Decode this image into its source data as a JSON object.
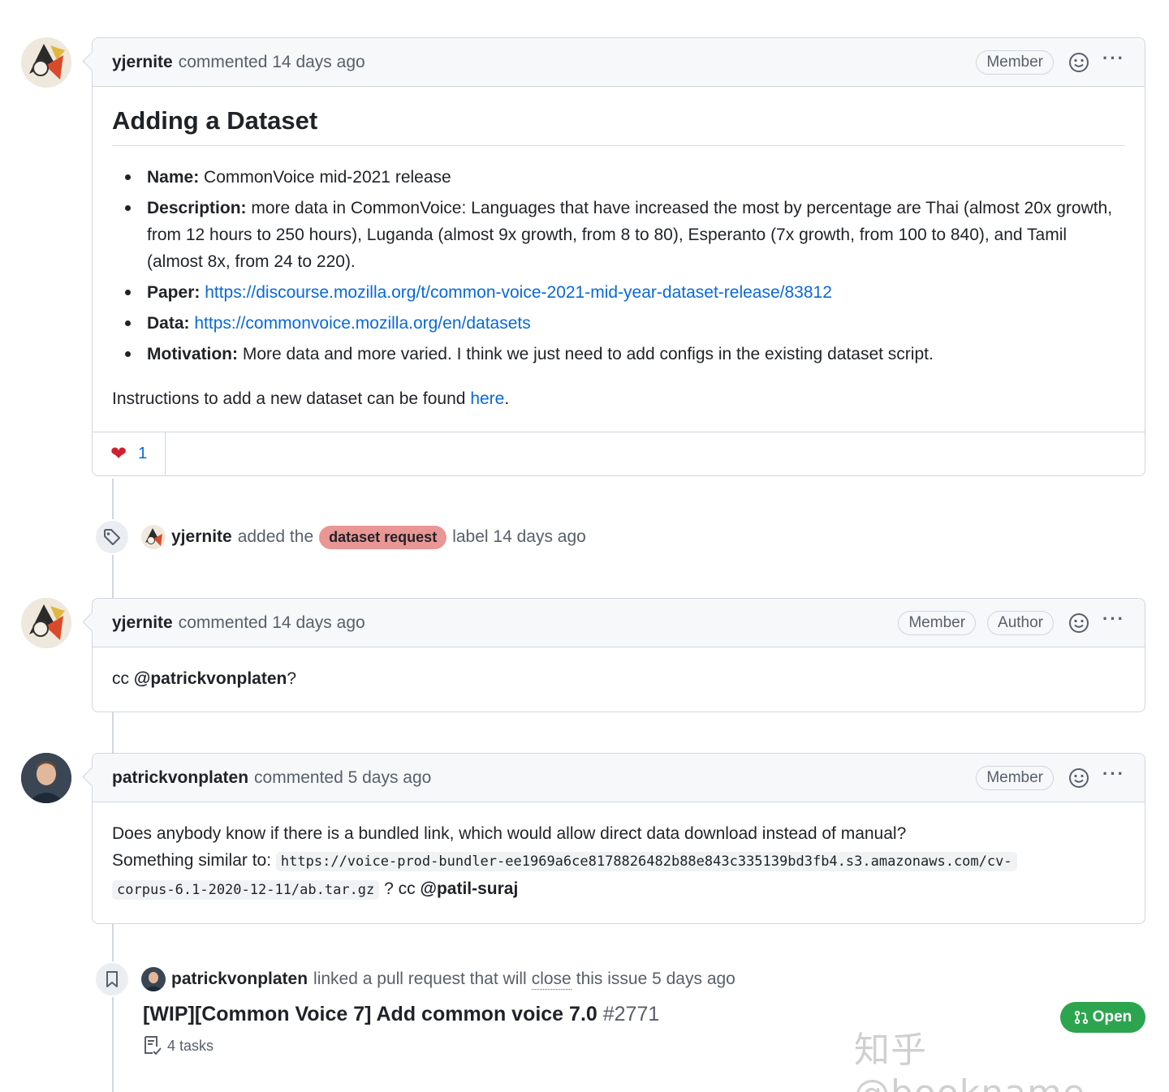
{
  "comments": [
    {
      "author": "yjernite",
      "meta": "commented 14 days ago",
      "badges": [
        "Member"
      ],
      "heading": "Adding a Dataset",
      "items": [
        {
          "label": "Name:",
          "text": "CommonVoice mid-2021 release"
        },
        {
          "label": "Description:",
          "text": "more data in CommonVoice: Languages that have increased the most by percentage are Thai (almost 20x growth, from 12 hours to 250 hours), Luganda (almost 9x growth, from 8 to 80), Esperanto (7x growth, from 100 to 840), and Tamil (almost 8x, from 24 to 220)."
        },
        {
          "label": "Paper:",
          "link": "https://discourse.mozilla.org/t/common-voice-2021-mid-year-dataset-release/83812"
        },
        {
          "label": "Data:",
          "link": "https://commonvoice.mozilla.org/en/datasets"
        },
        {
          "label": "Motivation:",
          "text": "More data and more varied. I think we just need to add configs in the existing dataset script."
        }
      ],
      "footer_text": "Instructions to add a new dataset can be found",
      "footer_link": "here",
      "footer_end": ".",
      "reaction_count": "1"
    },
    {
      "author": "yjernite",
      "meta": "commented 14 days ago",
      "badges": [
        "Member",
        "Author"
      ],
      "body_prefix": "cc",
      "body_mention": "@patrickvonplaten",
      "body_suffix": "?"
    },
    {
      "author": "patrickvonplaten",
      "meta": "commented 5 days ago",
      "badges": [
        "Member"
      ],
      "line1": "Does anybody know if there is a bundled link, which would allow direct data download instead of manual?",
      "line2_prefix": "Something similar to:",
      "code_part1": "https://voice-prod-bundler-ee1969a6ce8178826482b88e843c335139bd3fb4.s3.amazonaws.com/cv-",
      "code_part2": "corpus-6.1-2020-12-11/ab.tar.gz",
      "line2_suffix": "? cc",
      "mention": "@patil-suraj"
    }
  ],
  "label_event": {
    "actor": "yjernite",
    "text_before": "added the",
    "label": "dataset request",
    "text_after": "label 14 days ago"
  },
  "link_event": {
    "actor": "patrickvonplaten",
    "text_before": "linked a pull request that will",
    "keyword": "close",
    "text_after": "this issue 5 days ago"
  },
  "pull_request": {
    "title": "[WIP][Common Voice 7] Add common voice 7.0",
    "number": "#2771",
    "tasks": "4 tasks",
    "state": "Open"
  },
  "watermark": "知乎 @bookname",
  "colors": {
    "accent": "#0969da",
    "open_green": "#2da44e",
    "label_bg": "#e99695",
    "border": "#d0d7de"
  }
}
